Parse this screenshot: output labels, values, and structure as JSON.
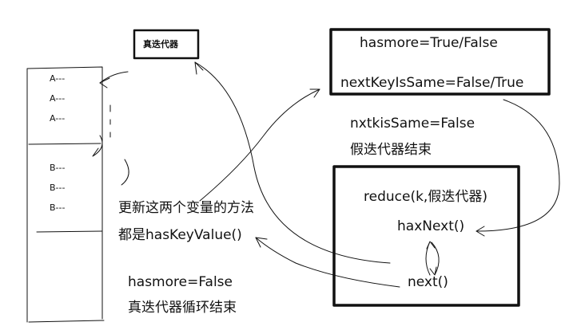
{
  "real_iterator": {
    "label": "真迭代器"
  },
  "records": {
    "group_a": [
      "A---",
      "A---",
      "A---"
    ],
    "group_b": [
      "B---",
      "B---",
      "B---"
    ]
  },
  "state_box": {
    "hasmore": "hasmore=True/False",
    "next_key_is_same": "nextKeyIsSame=False/True"
  },
  "fake_end_note": {
    "condition": "nxtkisSame=False",
    "result": "假迭代器结束"
  },
  "reducer_box": {
    "reduce_call": "reduce(k,假迭代器)",
    "has_next": "haxNext()",
    "next": "next()"
  },
  "update_note": {
    "line1": "更新这两个变量的方法",
    "line2": "都是hasKeyValue()"
  },
  "real_end_note": {
    "condition": "hasmore=False",
    "result": "真迭代器循环结束"
  },
  "colors": {
    "ink": "#111111",
    "background": "#ffffff"
  }
}
